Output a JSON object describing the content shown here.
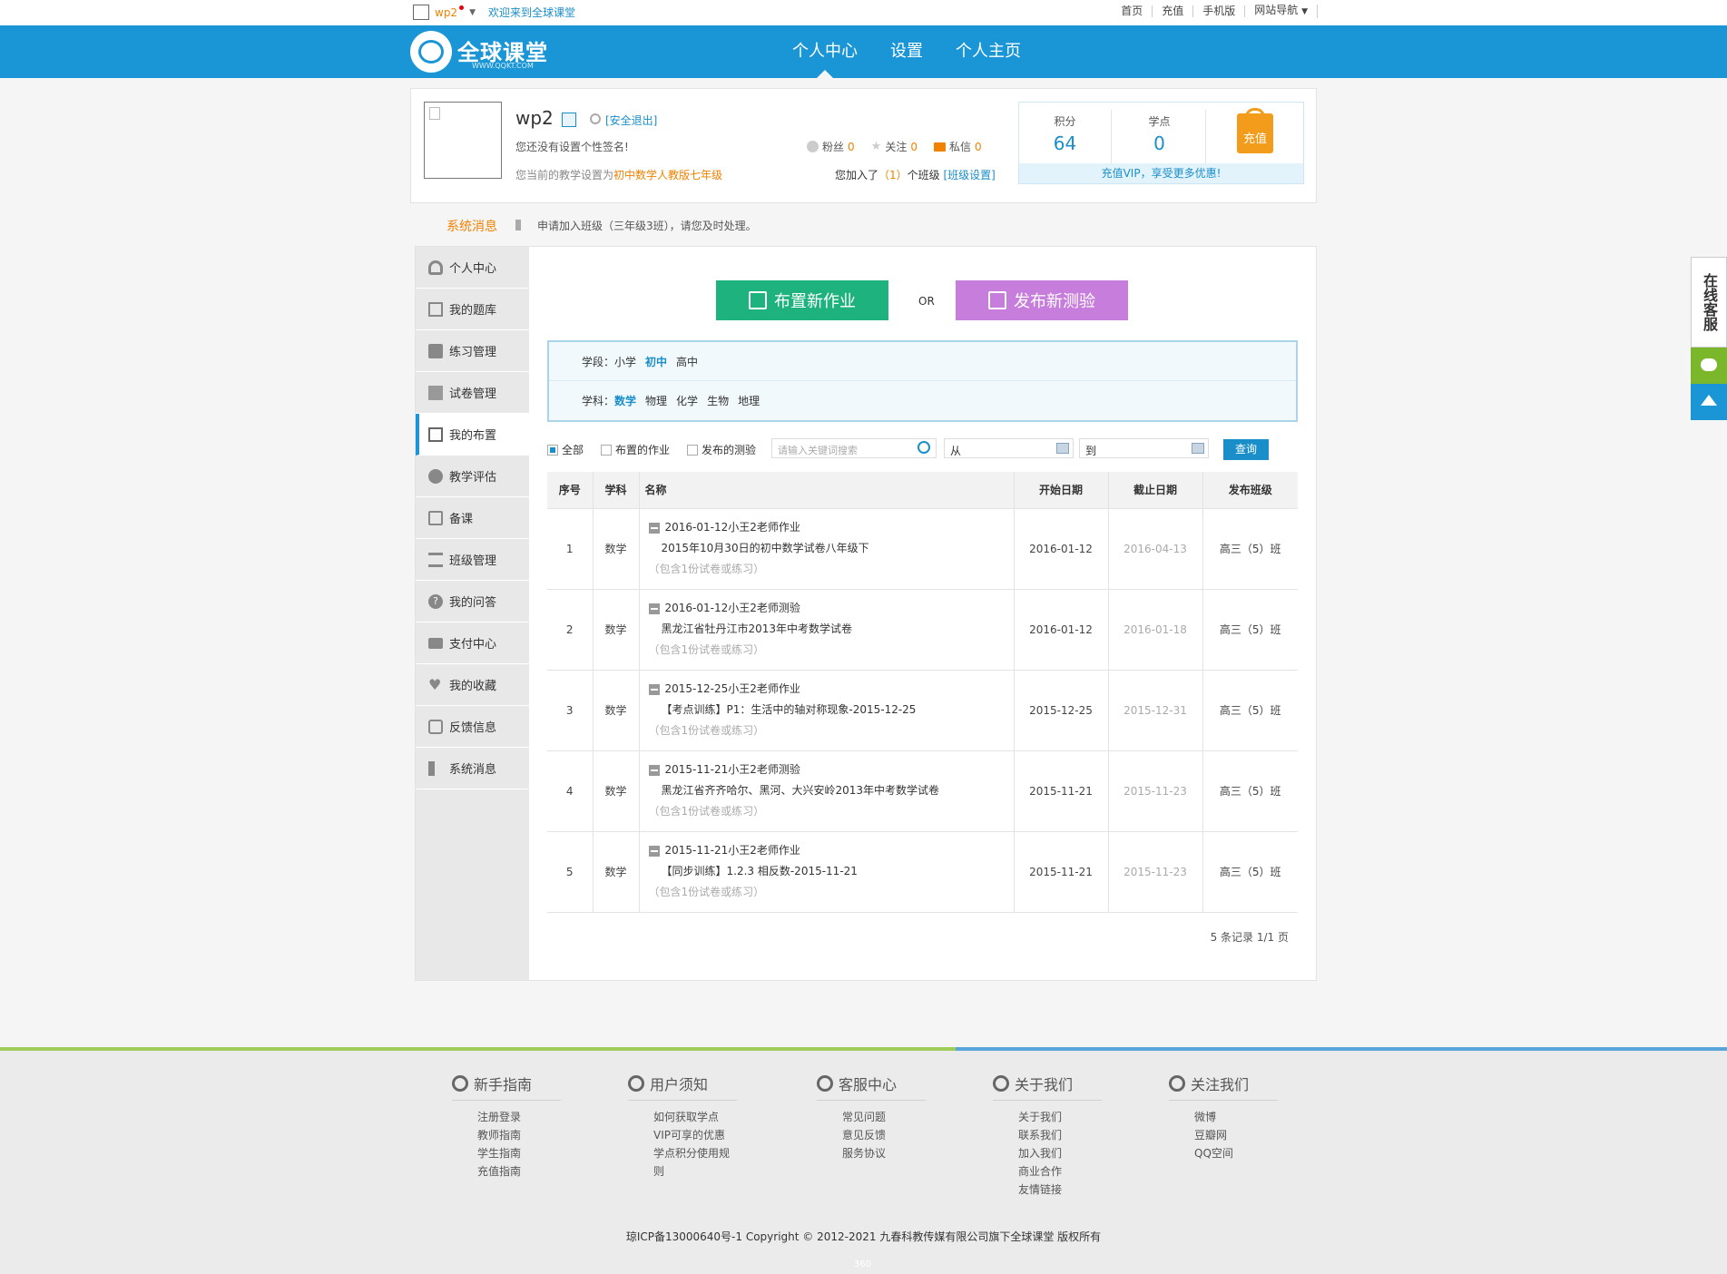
{
  "topbar": {
    "username": "wp2",
    "welcome": "欢迎来到全球课堂",
    "links": [
      "首页",
      "充值",
      "手机版",
      "网站导航"
    ]
  },
  "header": {
    "logo_name": "全球课堂",
    "logo_url": "WWW.QQKT.COM",
    "nav": [
      "个人中心",
      "设置",
      "个人主页"
    ],
    "active_nav": "个人中心",
    "color": "#1a96d6"
  },
  "profile": {
    "name": "wp2",
    "logout": "[安全退出]",
    "signature": "您还没有设置个性签名!",
    "setting_prefix": "您当前的教学设置为",
    "setting_value": "初中数学人教版七年级",
    "stats": [
      {
        "label": "粉丝",
        "value": "0",
        "icon": "smile-icon"
      },
      {
        "label": "关注",
        "value": "0",
        "icon": "star-icon"
      },
      {
        "label": "私信",
        "value": "0",
        "icon": "mail-icon"
      }
    ],
    "class_prefix": "您加入了",
    "class_count": "（1）",
    "class_suffix": "个班级",
    "class_link": "[班级设置]",
    "points_label": "积分",
    "points_value": "64",
    "study_label": "学点",
    "study_value": "0",
    "recharge": "充值",
    "vip_note": "充值VIP，享受更多优惠!"
  },
  "sysmsg": {
    "title": "系统消息",
    "text": "申请加入班级（三年级3班），请您及时处理。"
  },
  "sidebar": {
    "items": [
      {
        "label": "个人中心",
        "icon": "person-icon"
      },
      {
        "label": "我的题库",
        "icon": "edit-icon"
      },
      {
        "label": "练习管理",
        "icon": "book-icon"
      },
      {
        "label": "试卷管理",
        "icon": "paper-icon"
      },
      {
        "label": "我的布置",
        "icon": "clipboard-icon"
      },
      {
        "label": "教学评估",
        "icon": "pie-icon"
      },
      {
        "label": "备课",
        "icon": "document-icon"
      },
      {
        "label": "班级管理",
        "icon": "tree-icon"
      },
      {
        "label": "我的问答",
        "icon": "question-icon"
      },
      {
        "label": "支付中心",
        "icon": "card-icon"
      },
      {
        "label": "我的收藏",
        "icon": "heart-icon"
      },
      {
        "label": "反馈信息",
        "icon": "chat-icon"
      },
      {
        "label": "系统消息",
        "icon": "sound-icon"
      }
    ],
    "active": 4
  },
  "actions": {
    "assign_homework": "布置新作业",
    "or": "OR",
    "publish_test": "发布新测验",
    "assign_color": "#1db27e",
    "test_color": "#c77ddb"
  },
  "filters": {
    "stage_label": "学段：",
    "stages": [
      "小学",
      "初中",
      "高中"
    ],
    "stage_selected": "初中",
    "subject_label": "学科：",
    "subjects": [
      "数学",
      "物理",
      "化学",
      "生物",
      "地理"
    ],
    "subject_selected": "数学"
  },
  "search": {
    "opt_all": "全部",
    "opt_homework": "布置的作业",
    "opt_test": "发布的测验",
    "keyword_placeholder": "请输入关键词搜索",
    "from": "从",
    "to": "到",
    "query": "查询"
  },
  "table": {
    "headers": [
      "序号",
      "学科",
      "名称",
      "开始日期",
      "截止日期",
      "发布班级"
    ],
    "rows": [
      {
        "no": "1",
        "subject": "数学",
        "title": "2016-01-12小王2老师作业",
        "paper": "2015年10月30日的初中数学试卷八年级下",
        "note": "（包含1份试卷或练习）",
        "start": "2016-01-12",
        "end": "2016-04-13",
        "class": "高三（5）班"
      },
      {
        "no": "2",
        "subject": "数学",
        "title": "2016-01-12小王2老师测验",
        "paper": "黑龙江省牡丹江市2013年中考数学试卷",
        "note": "（包含1份试卷或练习）",
        "start": "2016-01-12",
        "end": "2016-01-18",
        "class": "高三（5）班"
      },
      {
        "no": "3",
        "subject": "数学",
        "title": "2015-12-25小王2老师作业",
        "paper": "【考点训练】P1：生活中的轴对称现象-2015-12-25",
        "note": "（包含1份试卷或练习）",
        "start": "2015-12-25",
        "end": "2015-12-31",
        "class": "高三（5）班"
      },
      {
        "no": "4",
        "subject": "数学",
        "title": "2015-11-21小王2老师测验",
        "paper": "黑龙江省齐齐哈尔、黑河、大兴安岭2013年中考数学试卷",
        "note": "（包含1份试卷或练习）",
        "start": "2015-11-21",
        "end": "2015-11-23",
        "class": "高三（5）班"
      },
      {
        "no": "5",
        "subject": "数学",
        "title": "2015-11-21小王2老师作业",
        "paper": "【同步训练】1.2.3 相反数-2015-11-21",
        "note": "（包含1份试卷或练习）",
        "start": "2015-11-21",
        "end": "2015-11-23",
        "class": "高三（5）班"
      }
    ]
  },
  "pager": "5 条记录 1/1 页",
  "float": {
    "service": "在线客服"
  },
  "footer": {
    "columns": [
      {
        "title": "新手指南",
        "icon": "compass-icon",
        "links": [
          "注册登录",
          "教师指南",
          "学生指南",
          "充值指南"
        ]
      },
      {
        "title": "用户须知",
        "icon": "gear-icon",
        "links": [
          "如何获取学点",
          "VIP可享的优惠",
          "学点积分使用规则"
        ]
      },
      {
        "title": "客服中心",
        "icon": "phone-icon",
        "links": [
          "常见问题",
          "意见反馈",
          "服务协议"
        ]
      },
      {
        "title": "关于我们",
        "icon": "people-icon",
        "links": [
          "关于我们",
          "联系我们",
          "加入我们",
          "商业合作",
          "友情链接"
        ]
      },
      {
        "title": "关注我们",
        "icon": "chat-icon",
        "links": [
          "微博",
          "豆瓣网",
          "QQ空间"
        ]
      }
    ],
    "copyright": "琼ICP备13000640号-1 Copyright © 2012-2021 九春科教传媒有限公司旗下全球课堂 版权所有",
    "badge": "360"
  }
}
